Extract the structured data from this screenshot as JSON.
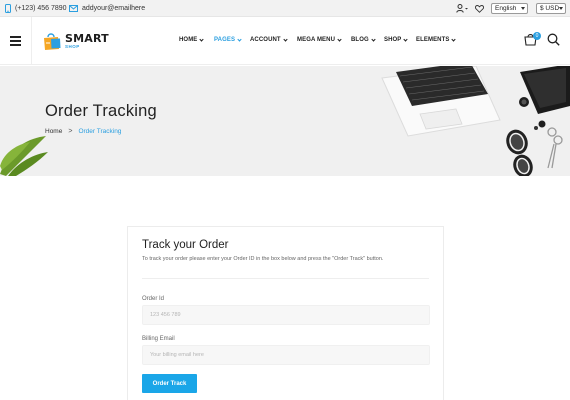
{
  "topbar": {
    "phone": "(+123) 456 7890",
    "email": "addyour@emailhere",
    "language": "English",
    "currency": "$ USD"
  },
  "logo": {
    "main": "SMART",
    "sub": "SHOP"
  },
  "nav": [
    {
      "label": "HOME",
      "active": false
    },
    {
      "label": "PAGES",
      "active": true
    },
    {
      "label": "ACCOUNT",
      "active": false
    },
    {
      "label": "MEGA MENU",
      "active": false
    },
    {
      "label": "BLOG",
      "active": false
    },
    {
      "label": "SHOP",
      "active": false
    },
    {
      "label": "ELEMENTS",
      "active": false
    }
  ],
  "cart": {
    "count": "0"
  },
  "banner": {
    "title": "Order Tracking",
    "breadcrumb": {
      "home": "Home",
      "separator": ">",
      "current": "Order Tracking"
    }
  },
  "form": {
    "heading": "Track your Order",
    "description": "To track your order please enter your Order ID in the box below and press the \"Order Track\" button.",
    "order_id_label": "Order Id",
    "order_id_placeholder": "123 456 789",
    "email_label": "Billing Email",
    "email_placeholder": "Your billing email here",
    "button": "Order Track"
  },
  "colors": {
    "accent": "#2b9fe0",
    "button": "#1aa6e8",
    "banner_bg": "#f0f0f0"
  },
  "icons": [
    "phone-icon",
    "mail-icon",
    "user-icon",
    "heart-icon",
    "menu-icon",
    "cart-icon",
    "search-icon"
  ]
}
